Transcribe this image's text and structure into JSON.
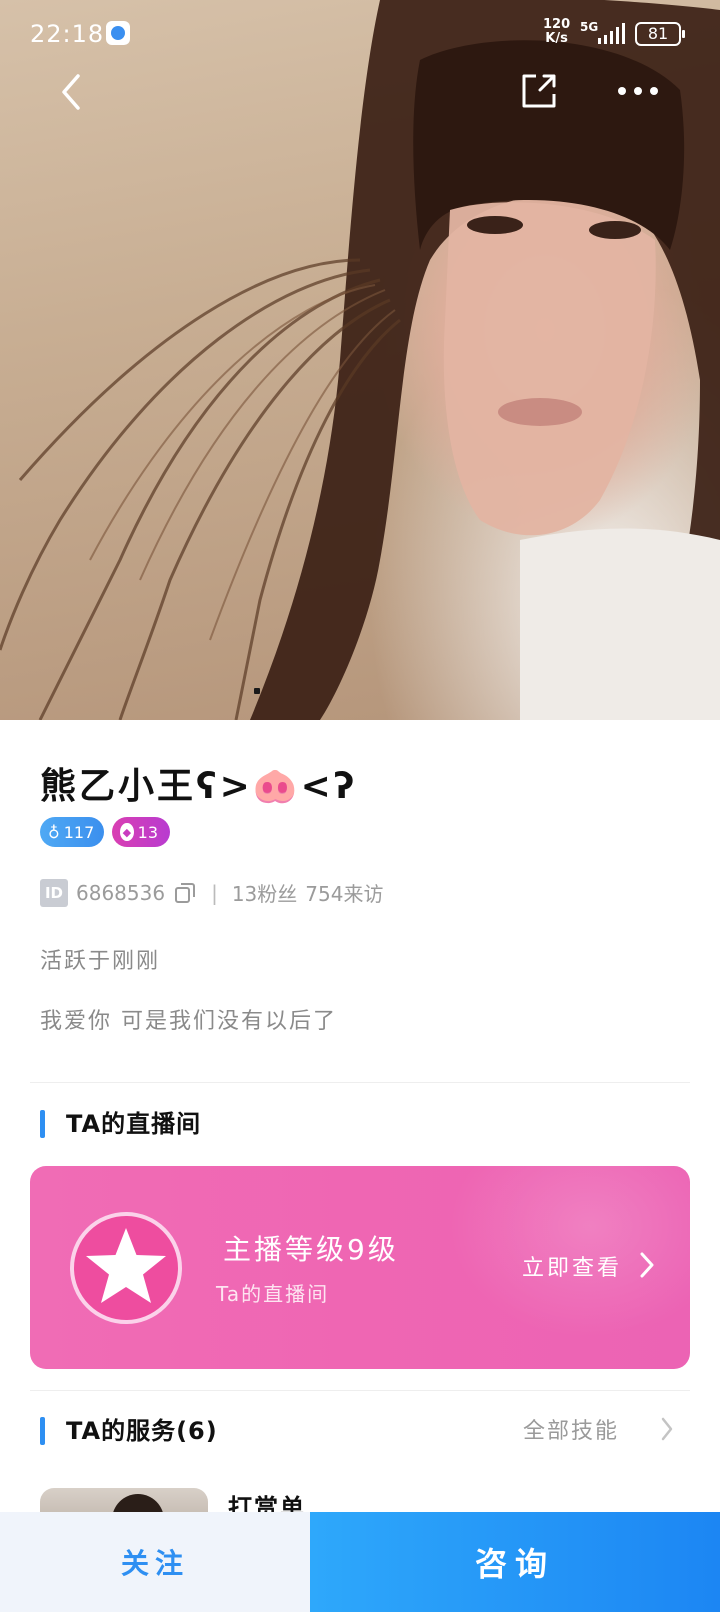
{
  "status_bar": {
    "time": "22:18",
    "speed_value": "120",
    "speed_unit": "K/s",
    "network": "5G",
    "battery": "81"
  },
  "icons": {
    "back": "chevron-left-icon",
    "share": "share-icon",
    "more": "more-dots-icon",
    "copy": "copy-icon",
    "live_badge": "star-icon"
  },
  "profile": {
    "name": "熊乙小王ʕ>🐽<ʔ",
    "badge_gender_level": "117",
    "badge_diamond_level": "13",
    "id_label": "ID",
    "id_value": "6868536",
    "fans": "13粉丝",
    "visits": "754来访",
    "active_status": "活跃于刚刚",
    "bio": "我爱你 可是我们没有以后了"
  },
  "live_section": {
    "title": "TA的直播间",
    "level": "主播等级9级",
    "subtitle": "Ta的直播间",
    "view_label": "立即查看"
  },
  "services_section": {
    "title": "TA的服务(6)",
    "all_label": "全部技能",
    "first_service_name": "打赏单"
  },
  "bottom_bar": {
    "follow_label": "关注",
    "consult_label": "咨询"
  },
  "colors": {
    "accent_blue": "#2e8ff2",
    "live_card_pink": "#ef66b3",
    "badge_blue": "#3b8fee",
    "badge_pink": "#c93cc0"
  }
}
